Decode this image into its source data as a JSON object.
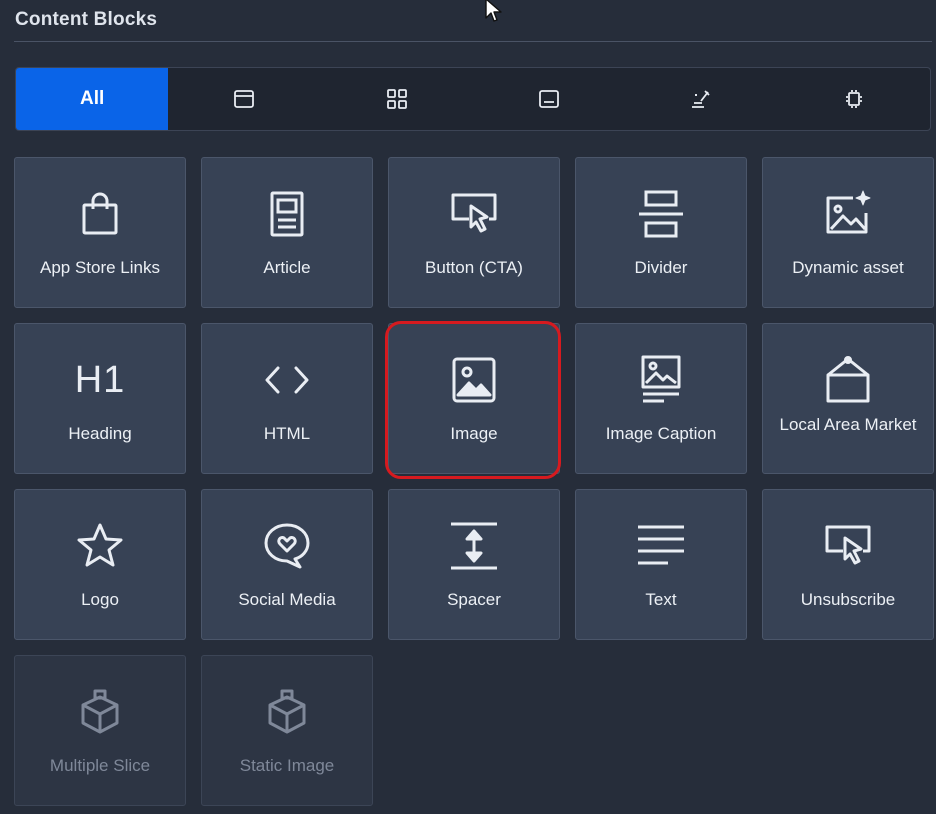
{
  "panel": {
    "title": "Content Blocks"
  },
  "tabs": [
    {
      "label": "All",
      "icon": "all",
      "active": true
    },
    {
      "label": "",
      "icon": "header-layout-icon"
    },
    {
      "label": "",
      "icon": "grid-layout-icon"
    },
    {
      "label": "",
      "icon": "footer-layout-icon"
    },
    {
      "label": "",
      "icon": "magic-icon"
    },
    {
      "label": "",
      "icon": "component-icon"
    }
  ],
  "blocks": [
    {
      "label": "App Store Links",
      "icon": "shopping-bag-icon"
    },
    {
      "label": "Article",
      "icon": "article-icon"
    },
    {
      "label": "Button (CTA)",
      "icon": "cursor-click-icon"
    },
    {
      "label": "Divider",
      "icon": "divider-icon"
    },
    {
      "label": "Dynamic asset",
      "icon": "sparkle-image-icon"
    },
    {
      "label": "Heading",
      "icon": "h1-icon",
      "glyph": "H1"
    },
    {
      "label": "HTML",
      "icon": "code-icon"
    },
    {
      "label": "Image",
      "icon": "image-icon",
      "highlighted": true
    },
    {
      "label": "Image Caption",
      "icon": "image-caption-icon"
    },
    {
      "label": "Local Area Market",
      "icon": "hanging-sign-icon"
    },
    {
      "label": "Logo",
      "icon": "star-icon"
    },
    {
      "label": "Social Media",
      "icon": "heart-bubble-icon"
    },
    {
      "label": "Spacer",
      "icon": "spacer-icon"
    },
    {
      "label": "Text",
      "icon": "text-lines-icon"
    },
    {
      "label": "Unsubscribe",
      "icon": "cursor-click-icon"
    },
    {
      "label": "Multiple Slice",
      "icon": "cube-icon",
      "disabled": true
    },
    {
      "label": "Static Image",
      "icon": "cube-icon",
      "disabled": true
    }
  ],
  "colors": {
    "background": "#262d3a",
    "tile": "#374255",
    "accent": "#0a64e8",
    "highlight": "#d61a1f"
  }
}
